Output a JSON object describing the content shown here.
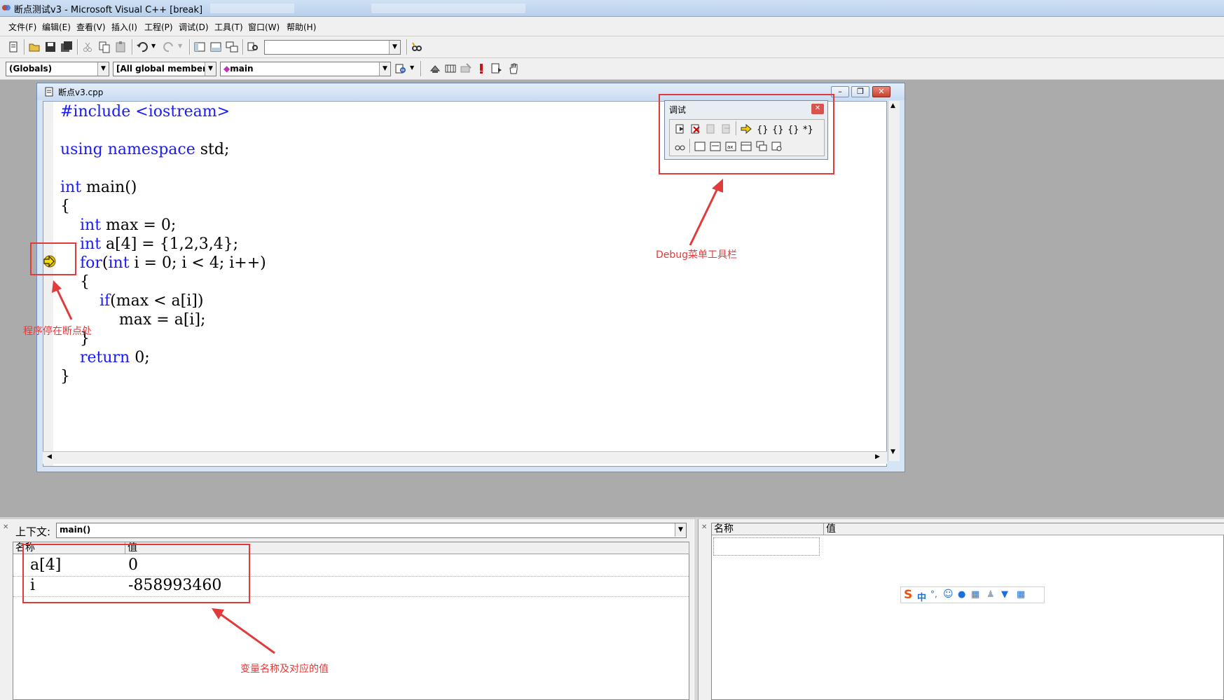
{
  "window": {
    "title": "断点测试v3 - Microsoft Visual C++ [break]"
  },
  "menu": [
    "文件(F)",
    "编辑(E)",
    "查看(V)",
    "插入(I)",
    "工程(P)",
    "调试(D)",
    "工具(T)",
    "窗口(W)",
    "帮助(H)"
  ],
  "toolbar2": {
    "scope_combo": "(Globals)",
    "members_combo": "[All global members",
    "function_combo": "main"
  },
  "editor": {
    "title": "断点v3.cpp",
    "code": [
      "#include <iostream>",
      "",
      "using namespace std;",
      "",
      "int main()",
      "{",
      "    int max = 0;",
      "    int a[4] = {1,2,3,4};",
      "    for(int i = 0; i < 4; i++)",
      "    {",
      "        if(max < a[i])",
      "            max = a[i];",
      "    }",
      "    return 0;",
      "}"
    ]
  },
  "debug_toolbar": {
    "title": "调试"
  },
  "annotations": {
    "debug_toolbar_label": "Debug菜单工具栏",
    "breakpoint_label": "程序停在断点处",
    "variables_label": "变量名称及对应的值"
  },
  "variables_pane": {
    "context_label": "上下文:",
    "context_value": "main()",
    "columns": [
      "名称",
      "值"
    ],
    "rows": [
      {
        "name": "a[4]",
        "value": "0"
      },
      {
        "name": "i",
        "value": "-858993460"
      }
    ]
  },
  "watch_pane": {
    "columns": [
      "名称",
      "值"
    ]
  },
  "ime": {
    "label": "中"
  },
  "colors": {
    "annotation": "#e23a3a",
    "keyword": "#1a1aff"
  }
}
